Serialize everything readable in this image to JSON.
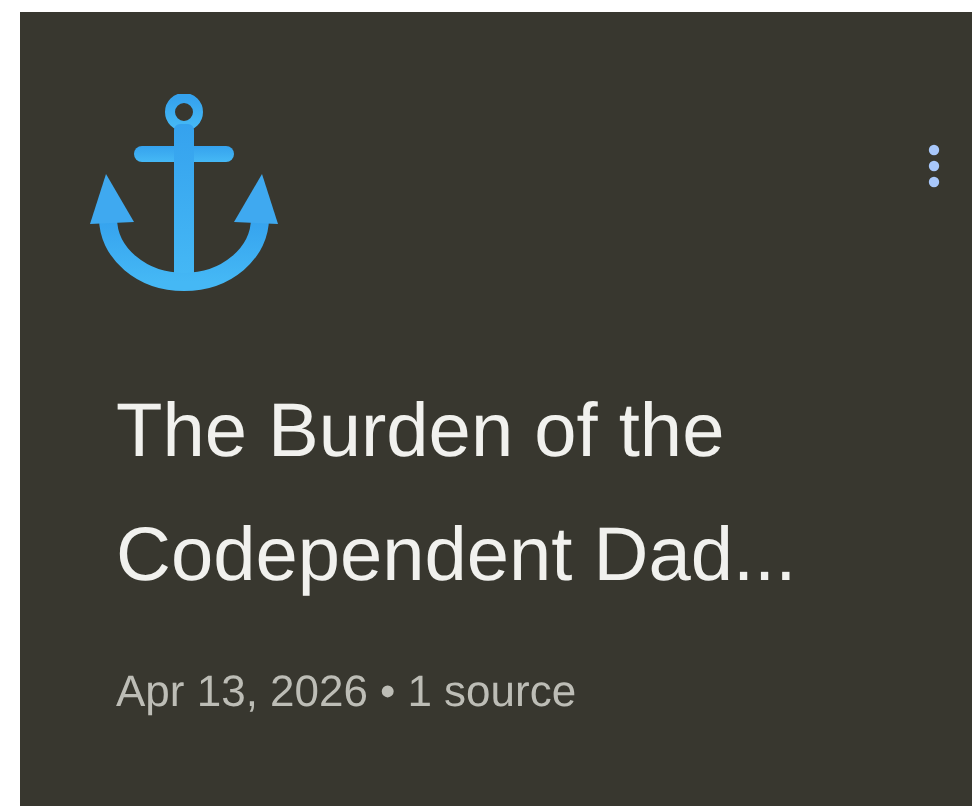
{
  "card": {
    "title": "The Burden of the Codependent Dad...",
    "date": "Apr 13, 2026",
    "separator": "•",
    "sources": "1 source"
  }
}
